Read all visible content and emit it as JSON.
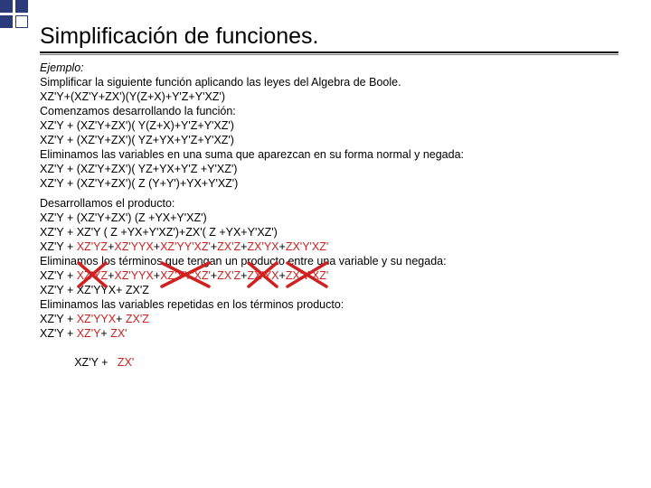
{
  "title": "Simplificación de funciones.",
  "b1": {
    "l1": "Ejemplo:",
    "l2": "Simplificar la siguiente función aplicando las leyes del Algebra de Boole.",
    "l3": "XZ'Y+(XZ'Y+ZX')(Y(Z+X)+Y'Z+Y'XZ')",
    "l4": "Comenzamos desarrollando la función:",
    "l5": "XZ'Y + (XZ'Y+ZX')( Y(Z+X)+Y'Z+Y'XZ')",
    "l6": "XZ'Y + (XZ'Y+ZX')( YZ+YX+Y'Z+Y'XZ')",
    "l7": "Eliminamos las variables en una suma que aparezcan en su forma normal y negada:",
    "l8": "XZ'Y + (XZ'Y+ZX')( YZ+YX+Y'Z +Y'XZ')",
    "l9": "XZ'Y + (XZ'Y+ZX')( Z (Y+Y')+YX+Y'XZ')"
  },
  "b2": {
    "l1": "Desarrollamos el producto:",
    "l2": "XZ'Y + (XZ'Y+ZX') (Z  +YX+Y'XZ')",
    "l3": "XZ'Y + XZ'Y  ( Z +YX+Y'XZ')+ZX'( Z +YX+Y'XZ')",
    "l4a": "XZ'Y + ",
    "l4b": "XZ'YZ",
    "l4c": "+",
    "l4d": "XZ'YYX",
    "l4e": "+",
    "l4f": "XZ'YY'XZ'",
    "l4g": "+",
    "l4h": "ZX'Z",
    "l4i": "+",
    "l4j": "ZX'YX",
    "l4k": "+",
    "l4l": "ZX'Y'XZ'",
    "l5": "Eliminamos los términos que tengan un producto entre una variable y su negada:",
    "l6a": "XZ'Y + ",
    "l6b": "XZ'YZ",
    "l6c": "+",
    "l6d": "XZ'YYX",
    "l6e": "+",
    "l6f": "XZ'YY'XZ'",
    "l6g": "+",
    "l6h": "ZX'Z",
    "l6i": "+",
    "l6j": "ZX'YX",
    "l6k": "+",
    "l6l": "ZX'Y'XZ'",
    "l7": "XZ'Y + XZ'YYX+ ZX'Z",
    "l8": "Eliminamos las variables repetidas en los términos producto:",
    "l9a": "XZ'Y + ",
    "l9b": "XZ'YYX",
    "l9c": "+ ",
    "l9d": "ZX'Z",
    "l10a": "XZ'Y + ",
    "l10b": "XZ'Y",
    "l10c": "+  ",
    "l10d": "ZX'",
    "l11a": "   XZ'Y +   ",
    "l11b": "ZX'"
  },
  "colors": {
    "red": "#d02020"
  }
}
